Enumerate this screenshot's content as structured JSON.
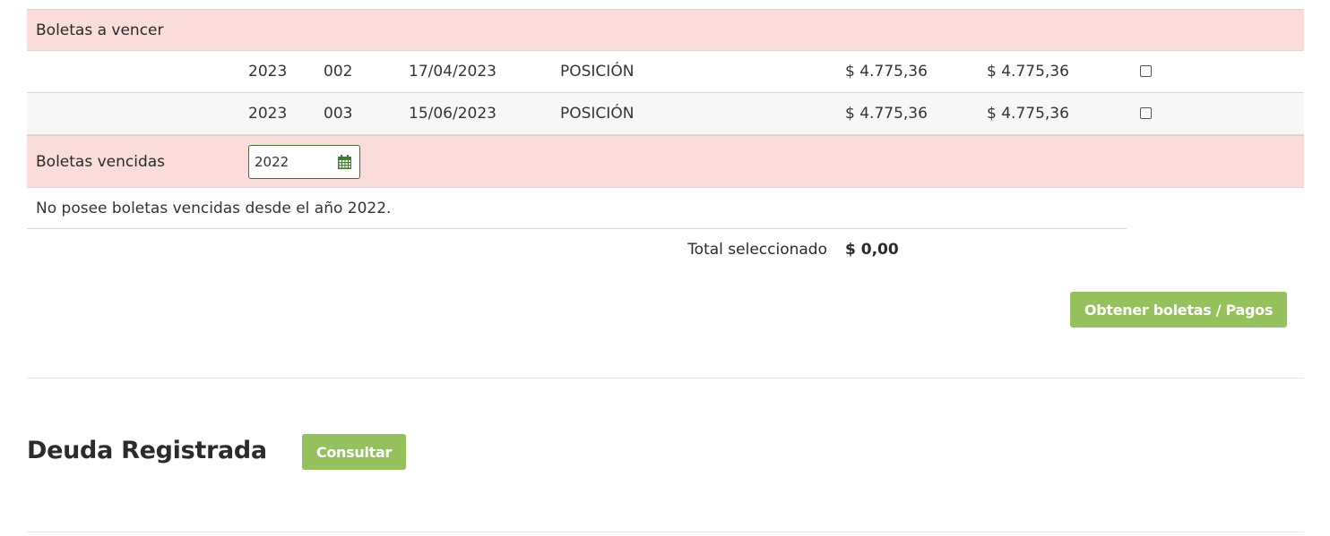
{
  "colors": {
    "section_bg": "#fadddb",
    "alt_row_bg": "#f7f7f7",
    "button_green": "#95c15c",
    "calendar_icon": "#3f7d2f"
  },
  "boletas_a_vencer": {
    "title": "Boletas a vencer",
    "rows": [
      {
        "year": "2023",
        "number": "002",
        "due_date": "17/04/2023",
        "concept": "POSICIÓN",
        "amount": "$ 4.775,36",
        "amount_total": "$ 4.775,36",
        "checked": false
      },
      {
        "year": "2023",
        "number": "003",
        "due_date": "15/06/2023",
        "concept": "POSICIÓN",
        "amount": "$ 4.775,36",
        "amount_total": "$ 4.775,36",
        "checked": false
      }
    ]
  },
  "boletas_vencidas": {
    "title": "Boletas vencidas",
    "year_value": "2022",
    "year_icon": "calendar-icon",
    "empty_message": "No posee boletas vencidas desde el año 2022."
  },
  "total": {
    "label": "Total seleccionado",
    "value": "$ 0,00"
  },
  "actions": {
    "obtener_label": "Obtener boletas / Pagos"
  },
  "deuda": {
    "title": "Deuda Registrada",
    "consultar_label": "Consultar"
  }
}
